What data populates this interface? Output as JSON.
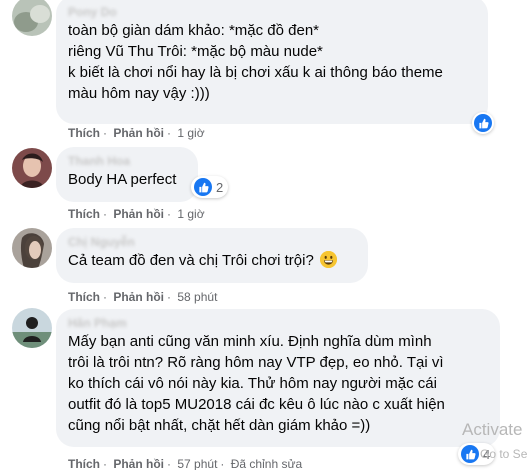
{
  "comments": [
    {
      "author": "Pony Do",
      "lines": [
        "toàn bộ giàn dám khảo: *mặc đồ đen*",
        "riêng Vũ Thu Trôi: *mặc bộ màu nude*",
        "k biết là chơi nổi hay là bị chơi xấu k ai thông báo theme",
        "màu hôm nay vậy :)))"
      ],
      "like_label": "Thích",
      "reply_label": "Phản hồi",
      "time": "1 giờ",
      "reaction_icon": "like-icon"
    },
    {
      "author": "Thanh Hoa",
      "lines": [
        "Body HA perfect"
      ],
      "like_label": "Thích",
      "reply_label": "Phản hồi",
      "time": "1 giờ",
      "reaction_icon": "like-icon",
      "reaction_count": "2"
    },
    {
      "author": "Chị Nguyễn",
      "lines": [
        "Cả team đồ đen và chị Trôi chơi trội?"
      ],
      "emoji": "grin-emoji",
      "like_label": "Thích",
      "reply_label": "Phản hồi",
      "time": "58 phút"
    },
    {
      "author": "Hân Phạm",
      "lines": [
        "Mấy bạn anti cũng văn minh xíu. Định nghĩa dùm mình",
        "trôi là trôi ntn? Rõ ràng hôm nay VTP đẹp, eo nhỏ. Tại vì",
        "ko thích cái vô nói này kia. Thử hôm nay người mặc cái",
        "outfit đó là top5 MU2018 cái đc kêu ô lúc nào c xuất hiện",
        "cũng nổi bật nhất, chặt hết dàn giám khảo =))"
      ],
      "like_label": "Thích",
      "reply_label": "Phản hồi",
      "time": "57 phút",
      "edited_label": "Đã chỉnh sửa",
      "reaction_icon": "like-icon",
      "reaction_count": "4"
    }
  ],
  "watermark": {
    "line1": "Activate",
    "line2": "Go to Se"
  },
  "colors": {
    "bubble": "#f0f2f5",
    "like_blue": "#1877f2",
    "meta_text": "#65676b"
  }
}
